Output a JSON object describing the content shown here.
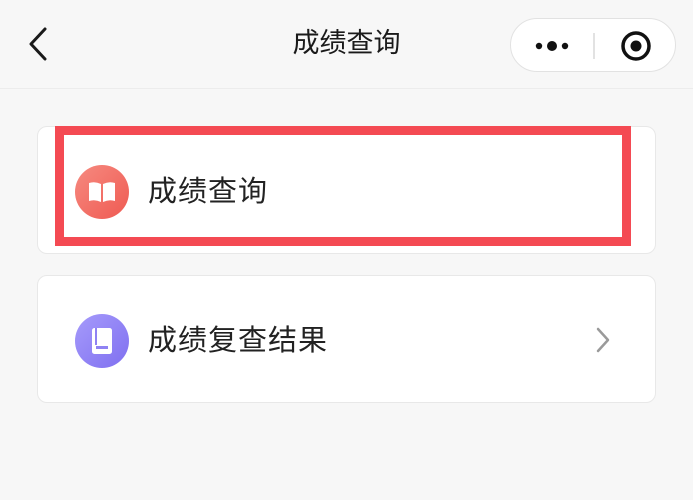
{
  "navbar": {
    "title": "成绩查询",
    "back_icon": "chevron-left-icon",
    "more_icon": "more-dots-icon",
    "close_icon": "target-close-icon"
  },
  "menu": {
    "items": [
      {
        "label": "成绩查询",
        "icon": "open-book-icon",
        "icon_color": "#ef5a52",
        "highlighted": true
      },
      {
        "label": "成绩复查结果",
        "icon": "book-icon",
        "icon_color": "#7f6ff0",
        "has_chevron": true
      }
    ]
  },
  "colors": {
    "highlight": "#f44a53",
    "background": "#f7f7f7",
    "card": "#ffffff"
  }
}
